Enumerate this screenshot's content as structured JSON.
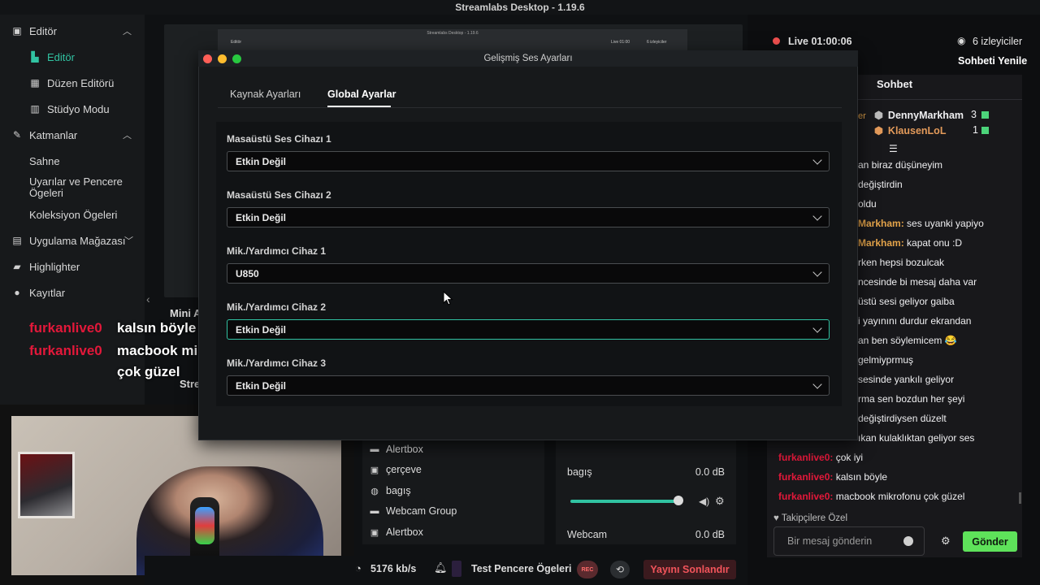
{
  "window": {
    "title": "Streamlabs Desktop - 1.19.6"
  },
  "sidebar": {
    "items": [
      {
        "label": "Editör",
        "icon": "editor-icon"
      },
      {
        "label": "Editör",
        "icon": "layout-editor-icon"
      },
      {
        "label": "Düzen Editörü",
        "icon": "grid-icon"
      },
      {
        "label": "Stüdyo Modu",
        "icon": "studio-icon"
      },
      {
        "label": "Katmanlar",
        "icon": "layers-icon"
      },
      {
        "label": "Sahne"
      },
      {
        "label": "Uyarılar ve Pencere Ögeleri"
      },
      {
        "label": "Koleksiyon Ögeleri"
      },
      {
        "label": "Uygulama Mağazası",
        "icon": "store-icon"
      },
      {
        "label": "Highlighter",
        "icon": "highlighter-icon"
      },
      {
        "label": "Kayıtlar",
        "icon": "recordings-icon"
      }
    ]
  },
  "overlay_chat": [
    {
      "user": "furkanlive0",
      "message": "kalsın böyle"
    },
    {
      "user": "furkanlive0",
      "message": "macbook mikrofonu"
    },
    {
      "user": "",
      "message": "çok güzel"
    }
  ],
  "behind": {
    "mini": "Mini A",
    "stream": "Stre"
  },
  "sources": [
    {
      "label": "Alertbox",
      "icon": "folder-icon"
    },
    {
      "label": "çerçeve",
      "icon": "image-icon"
    },
    {
      "label": "bagış",
      "icon": "globe-icon"
    },
    {
      "label": "Webcam Group",
      "icon": "folder-icon"
    },
    {
      "label": "Alertbox",
      "icon": "image-icon"
    }
  ],
  "mixer": [
    {
      "name": "bagış",
      "db": "0.0 dB"
    },
    {
      "name": "Webcam",
      "db": "0.0 dB"
    }
  ],
  "footer": {
    "bitrate": "5176 kb/s",
    "test_widgets": "Test Pencere Ögeleri",
    "rec": "REC",
    "end_stream": "Yayını Sonlandır"
  },
  "chat_panel": {
    "live": "Live 01:00:06",
    "viewers": "6 izleyiciler",
    "refresh": "Sohbeti Yenile",
    "header": "Sohbet",
    "top_cut": "er",
    "ranks": [
      {
        "name": "DennyMarkham",
        "count": "3",
        "color": "#efeff1"
      },
      {
        "name": "KlausenLoL",
        "count": "1",
        "color": "#e39a5a"
      }
    ],
    "messages": [
      {
        "user": "",
        "text": "an biraz düşüneyim",
        "user_color": ""
      },
      {
        "user": "",
        "text": "değiştirdin",
        "user_color": ""
      },
      {
        "user": "",
        "text": "oldu",
        "user_color": ""
      },
      {
        "user": "Markham:",
        "text": " ses uyanki yapiyo",
        "user_color": "#e3a34a"
      },
      {
        "user": "Markham:",
        "text": " kapat onu :D",
        "user_color": "#e3a34a"
      },
      {
        "user": "",
        "text": "rken hepsi bozulcak",
        "user_color": ""
      },
      {
        "user": "",
        "text": "ncesinde bi mesaj daha var",
        "user_color": ""
      },
      {
        "user": "",
        "text": "üstü sesi geliyor gaiba",
        "user_color": ""
      },
      {
        "user": "",
        "text": "i yayınını durdur ekrandan",
        "user_color": ""
      },
      {
        "user": "",
        "text": "an ben söylemicem 😂",
        "user_color": ""
      },
      {
        "user": "",
        "text": "gelmiyprmuş",
        "user_color": ""
      },
      {
        "user": "",
        "text": "sesinde yankılı geliyor",
        "user_color": ""
      },
      {
        "user": "",
        "text": "rma sen bozdun her şeyi",
        "user_color": ""
      },
      {
        "user": "",
        "text": "değiştirdiysen düzelt",
        "user_color": ""
      },
      {
        "user": "",
        "text": "ıkan kulaklıktan geliyor ses",
        "user_color": ""
      },
      {
        "user": "furkanlive0:",
        "text": " çok iyi",
        "user_color": "#e3183a"
      },
      {
        "user": "furkanlive0:",
        "text": " kalsın böyle",
        "user_color": "#e3183a"
      },
      {
        "user": "furkanlive0:",
        "text": " macbook mikrofonu çok güzel",
        "user_color": "#e3183a"
      }
    ],
    "follow_only": "Takipçilere Özel",
    "input_placeholder": "Bir mesaj gönderin",
    "send": "Gönder"
  },
  "modal": {
    "title": "Gelişmiş Ses Ayarları",
    "tabs": [
      "Kaynak Ayarları",
      "Global Ayarlar"
    ],
    "active_tab": "Global Ayarlar",
    "fields": [
      {
        "label": "Masaüstü Ses Cihazı 1",
        "value": "Etkin Değil"
      },
      {
        "label": "Masaüstü Ses Cihazı 2",
        "value": "Etkin Değil"
      },
      {
        "label": "Mik./Yardımcı Cihaz 1",
        "value": "U850"
      },
      {
        "label": "Mik./Yardımcı Cihaz 2",
        "value": "Etkin Değil"
      },
      {
        "label": "Mik./Yardımcı Cihaz 3",
        "value": "Etkin Değil"
      }
    ]
  },
  "mini_window": {
    "title": "Streamlabs Desktop - 1.19.6",
    "editor": "Editör",
    "live": "Live 01:00",
    "viewers": "6 izleyiciler"
  },
  "colors": {
    "accent": "#31c3a2",
    "live_red": "#f0504f",
    "send_green": "#5ee25a",
    "overlay_user": "#e3183a"
  }
}
